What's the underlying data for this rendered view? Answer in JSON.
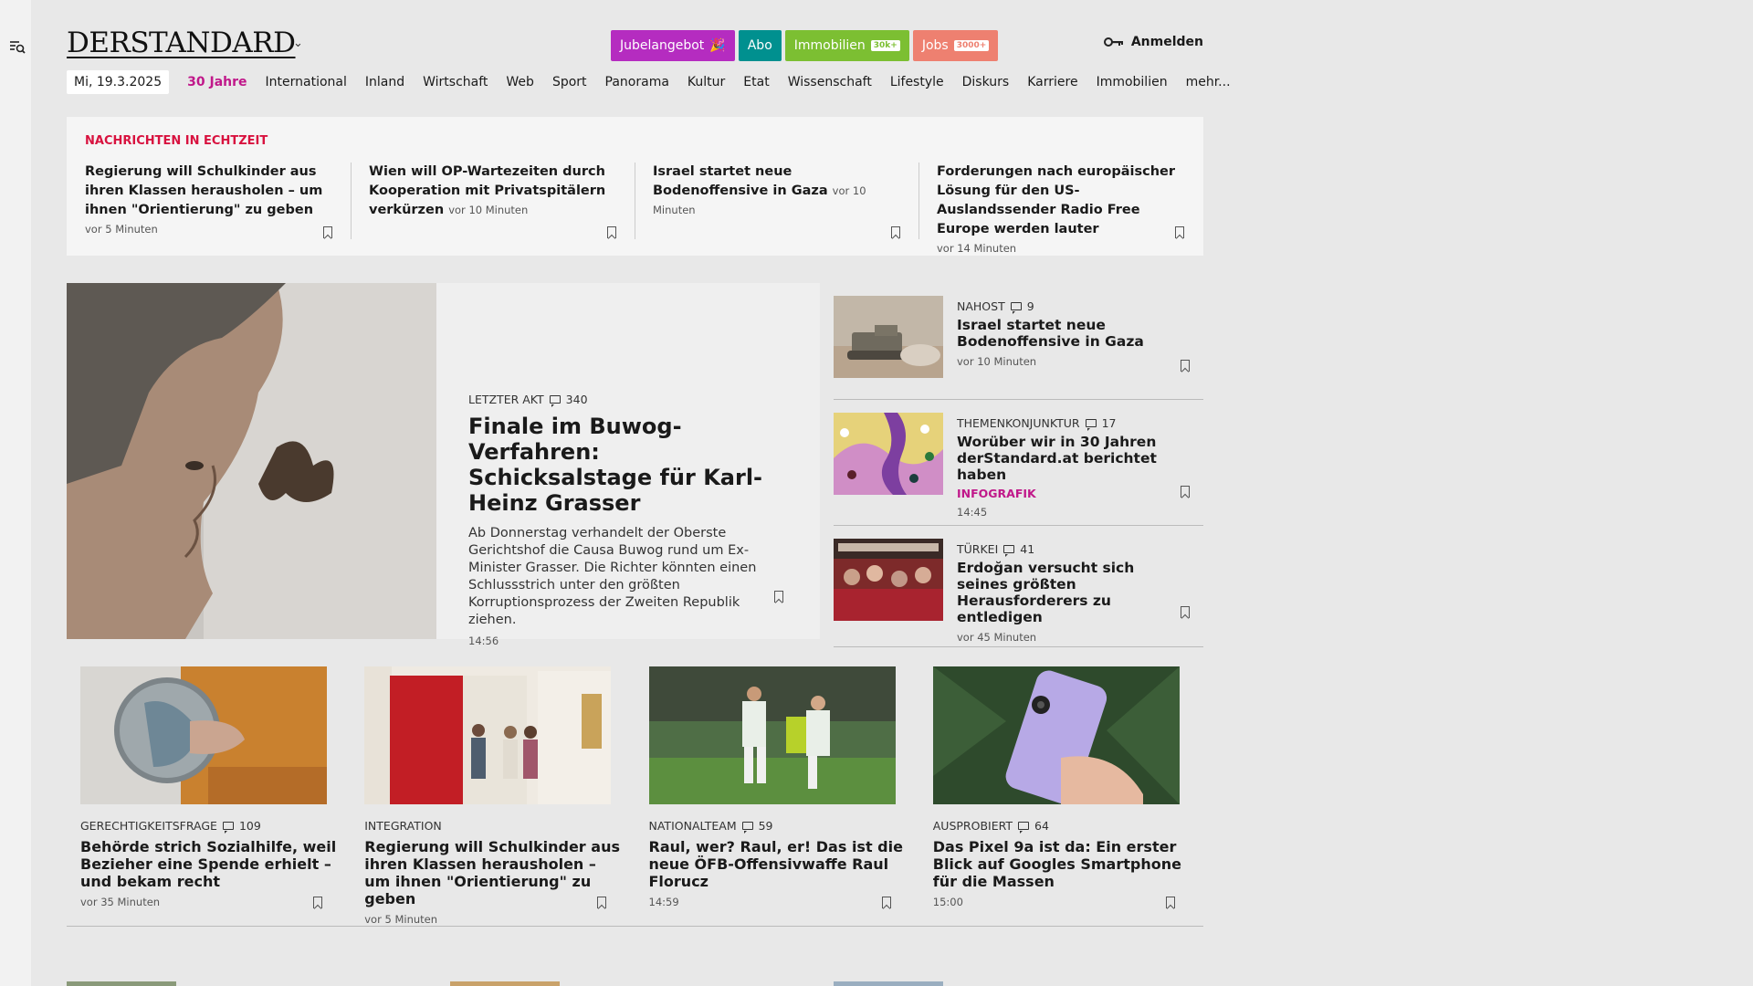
{
  "header": {
    "logo": "DERSTANDARD",
    "promos": [
      {
        "label": "Jubelangebot",
        "color": "#b52cc0",
        "icon": "confetti-icon"
      },
      {
        "label": "Abo",
        "color": "#00908f"
      },
      {
        "label": "Immobilien",
        "color": "#7cbf32",
        "tag": "30k+"
      },
      {
        "label": "Jobs",
        "color": "#ee8070",
        "tag": "3000+"
      }
    ],
    "login": "Anmelden"
  },
  "nav": {
    "date": "Mi, 19.3.2025",
    "items": [
      "30 Jahre",
      "International",
      "Inland",
      "Wirtschaft",
      "Web",
      "Sport",
      "Panorama",
      "Kultur",
      "Etat",
      "Wissenschaft",
      "Lifestyle",
      "Diskurs",
      "Karriere",
      "Immobilien",
      "mehr..."
    ]
  },
  "live": {
    "title": "NACHRICHTEN IN ECHTZEIT",
    "items": [
      {
        "title": "Regierung will Schulkinder aus ihren Klassen herausholen – um ihnen \"Orientierung\" zu geben",
        "time": "vor 5 Minuten"
      },
      {
        "title": "Wien will OP-Wartezeiten durch Kooperation mit Privatspitälern verkürzen",
        "time": "vor 10 Minuten"
      },
      {
        "title": "Israel startet neue Bodenoffensive in Gaza",
        "time": "vor 10 Minuten"
      },
      {
        "title": "Forderungen nach europäischer Lösung für den US-Auslandssender Radio Free Europe werden lauter",
        "time": "vor 14 Minuten"
      }
    ]
  },
  "hero": {
    "kicker": "LETZTER AKT",
    "comments": "340",
    "title": "Finale im Buwog-Verfahren: Schicksalstage für Karl-Heinz Grasser",
    "lead": "Ab Donnerstag verhandelt der Oberste Gerichtshof die Causa Buwog rund um Ex-Minister Grasser. Die Richter könnten einen Schlussstrich unter den größten Korruptionsprozess der Zweiten Republik ziehen.",
    "time": "14:56"
  },
  "side": [
    {
      "kicker": "NAHOST",
      "comments": "9",
      "title": "Israel startet neue Bodenoffensive in Gaza",
      "extra": "",
      "time": "vor 10 Minuten"
    },
    {
      "kicker": "THEMENKONJUNKTUR",
      "comments": "17",
      "title": "Worüber wir in 30 Jahren derStandard.at berichtet haben",
      "extra": "INFOGRAFIK",
      "time": "14:45"
    },
    {
      "kicker": "TÜRKEI",
      "comments": "41",
      "title": "Erdoğan versucht sich seines größten Herausforderers zu entledigen",
      "extra": "",
      "time": "vor 45 Minuten"
    }
  ],
  "grid": [
    {
      "kicker": "GERECHTIGKEITSFRAGE",
      "comments": "109",
      "title": "Behörde strich Sozialhilfe, weil Bezieher eine Spende erhielt – und bekam recht",
      "time": "vor 35 Minuten"
    },
    {
      "kicker": "INTEGRATION",
      "comments": "",
      "title": "Regierung will Schulkinder aus ihren Klassen herausholen – um ihnen \"Orientierung\" zu geben",
      "time": "vor 5 Minuten"
    },
    {
      "kicker": "NATIONALTEAM",
      "comments": "59",
      "title": "Raul, wer? Raul, er! Das ist die neue ÖFB-Offensivwaffe Raul Florucz",
      "time": "14:59"
    },
    {
      "kicker": "AUSPROBIERT",
      "comments": "64",
      "title": "Das Pixel 9a ist da: Ein erster Blick auf Googles Smartphone für die Massen",
      "time": "15:00"
    }
  ]
}
